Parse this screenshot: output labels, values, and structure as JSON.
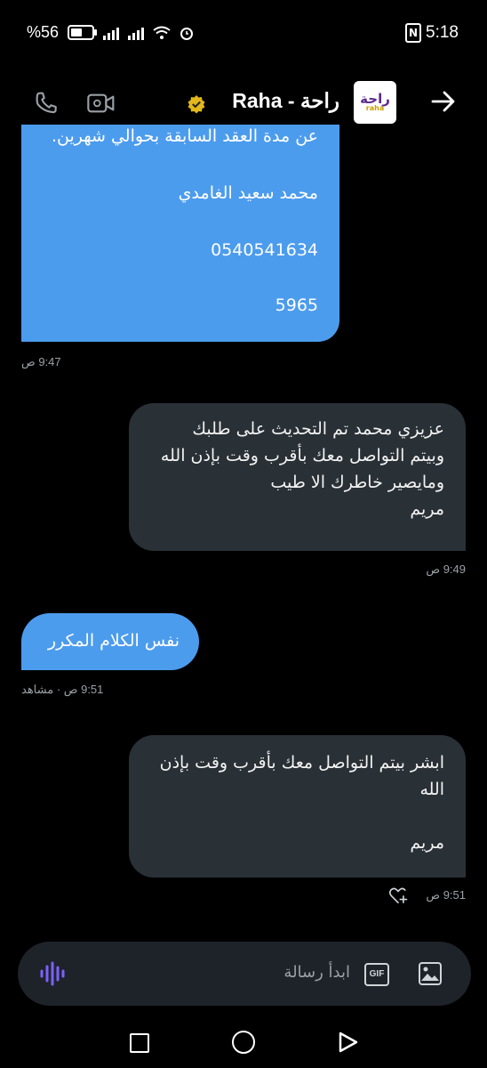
{
  "status_bar": {
    "battery": "%56",
    "time": "5:18",
    "nfc": "N"
  },
  "header": {
    "title": "Raha - راحة",
    "logo_text": "راحة",
    "logo_sub": "raha",
    "icons": [
      "phone-icon",
      "video-icon",
      "verified-badge-icon",
      "forward-arrow-icon"
    ]
  },
  "messages": [
    {
      "side": "incoming",
      "lines": [
        "عن مدة العقد السابقة بحوالي شهرين.",
        "محمد سعيد الغامدي",
        "0540541634",
        "5965"
      ],
      "time": "9:47 ص"
    },
    {
      "side": "outgoing",
      "text": "عزيزي محمد تم التحديث على طلبك\nوبيتم التواصل معك بأقرب وقت بإذن الله\nومايصير خاطرك الا طيب\nمريم",
      "time": "9:49 ص"
    },
    {
      "side": "incoming",
      "text": "نفس الكلام المكرر",
      "time": "9:51 ص · مشاهد"
    },
    {
      "side": "outgoing",
      "text": "ابشر بيتم التواصل معك بأقرب وقت بإذن\nالله\n\nمريم",
      "time": "9:51 ص"
    }
  ],
  "composer": {
    "placeholder": "ابدأ رسالة",
    "gif_label": "GIF"
  },
  "colors": {
    "incoming_bubble": "#4c9cee",
    "outgoing_bubble": "#293036",
    "background": "#000000",
    "accent_mic": "#7b61ff"
  }
}
